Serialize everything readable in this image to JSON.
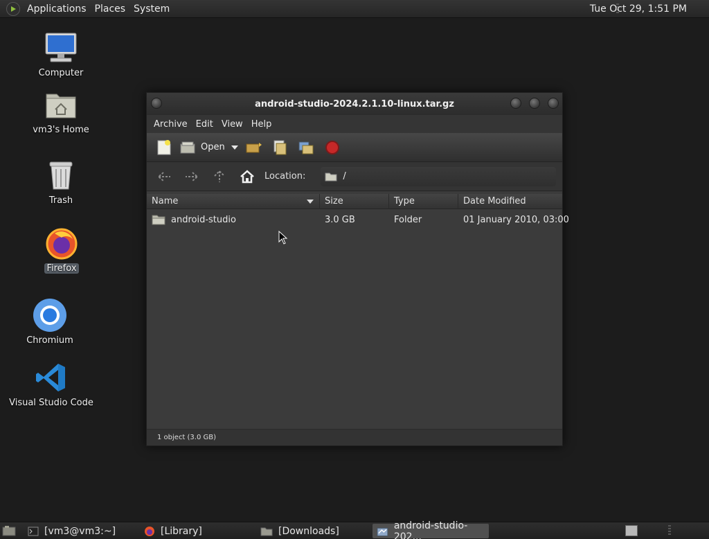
{
  "top_panel": {
    "menus": [
      "Applications",
      "Places",
      "System"
    ],
    "clock": "Tue Oct 29,  1:51 PM"
  },
  "desktop": {
    "icons": [
      {
        "label": "Computer",
        "icon": "computer-icon"
      },
      {
        "label": "vm3's Home",
        "icon": "home-folder-icon"
      },
      {
        "label": "Trash",
        "icon": "trash-icon"
      },
      {
        "label": "Firefox",
        "icon": "firefox-icon",
        "selected": true
      },
      {
        "label": "Chromium",
        "icon": "chromium-icon"
      },
      {
        "label": "Visual Studio Code",
        "icon": "vscode-icon"
      }
    ]
  },
  "window": {
    "title": "android-studio-2024.2.1.10-linux.tar.gz",
    "menu": [
      "Archive",
      "Edit",
      "View",
      "Help"
    ],
    "toolbar": {
      "open_label": "Open"
    },
    "location": {
      "label": "Location:",
      "path": "/"
    },
    "columns": [
      "Name",
      "Size",
      "Type",
      "Date Modified"
    ],
    "rows": [
      {
        "name": "android-studio",
        "size": "3.0 GB",
        "type": "Folder",
        "date": "01 January 2010, 03:00"
      }
    ],
    "status": "1 object (3.0 GB)"
  },
  "taskbar": {
    "tasks": [
      {
        "label": "[vm3@vm3:~]",
        "icon": "terminal-icon"
      },
      {
        "label": "[Library]",
        "icon": "firefox-icon"
      },
      {
        "label": "[Downloads]",
        "icon": "folder-icon"
      },
      {
        "label": "android-studio-202...",
        "icon": "archive-icon",
        "active": true
      }
    ]
  },
  "colors": {
    "desktop_bg": "#1c1c1c",
    "window_bg": "#3b3b3b",
    "stop_red": "#c62828"
  }
}
